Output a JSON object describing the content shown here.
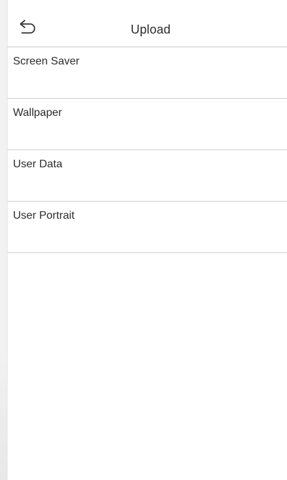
{
  "header": {
    "title": "Upload"
  },
  "menu": {
    "items": [
      {
        "label": "Screen Saver"
      },
      {
        "label": "Wallpaper"
      },
      {
        "label": "User Data"
      },
      {
        "label": "User Portrait"
      }
    ]
  },
  "icons": {
    "back": "back-arrow-icon"
  }
}
